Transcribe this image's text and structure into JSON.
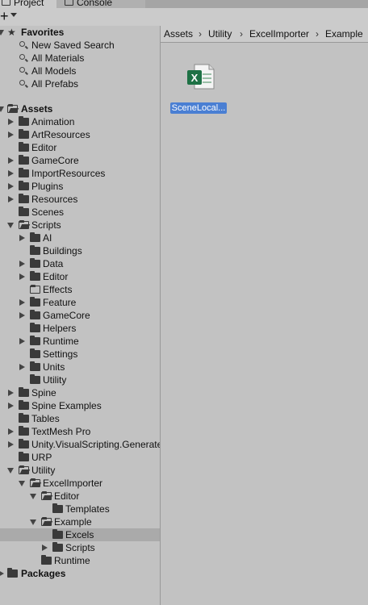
{
  "tabs": [
    {
      "label": "Project",
      "icon": "folder-icon"
    },
    {
      "label": "Console",
      "icon": "console-icon"
    }
  ],
  "toolbar": {
    "add_label": "+"
  },
  "tree": {
    "favorites": {
      "label": "Favorites",
      "items": [
        "New Saved Search",
        "All Materials",
        "All Models",
        "All Prefabs"
      ]
    },
    "assets_label": "Assets",
    "nodes": [
      {
        "label": "Animation"
      },
      {
        "label": "ArtResources"
      },
      {
        "label": "Editor"
      },
      {
        "label": "GameCore"
      },
      {
        "label": "ImportResources"
      },
      {
        "label": "Plugins"
      },
      {
        "label": "Resources"
      },
      {
        "label": "Scenes"
      },
      {
        "label": "Scripts"
      },
      {
        "label": "AI"
      },
      {
        "label": "Buildings"
      },
      {
        "label": "Data"
      },
      {
        "label": "Editor"
      },
      {
        "label": "Effects"
      },
      {
        "label": "Feature"
      },
      {
        "label": "GameCore"
      },
      {
        "label": "Helpers"
      },
      {
        "label": "Runtime"
      },
      {
        "label": "Settings"
      },
      {
        "label": "Units"
      },
      {
        "label": "Utility"
      },
      {
        "label": "Spine"
      },
      {
        "label": "Spine Examples"
      },
      {
        "label": "Tables"
      },
      {
        "label": "TextMesh Pro"
      },
      {
        "label": "Unity.VisualScripting.Generated"
      },
      {
        "label": "URP"
      },
      {
        "label": "Utility"
      },
      {
        "label": "ExcelImporter"
      },
      {
        "label": "Editor"
      },
      {
        "label": "Templates"
      },
      {
        "label": "Example"
      },
      {
        "label": "Excels"
      },
      {
        "label": "Scripts"
      },
      {
        "label": "Runtime"
      }
    ],
    "packages_label": "Packages"
  },
  "breadcrumb": [
    "Assets",
    "Utility",
    "ExcelImporter",
    "Example"
  ],
  "assets": [
    {
      "label": "SceneLocal...",
      "icon": "excel-file-icon",
      "color": "#1e7145"
    }
  ],
  "colors": {
    "selection": "#4a7fd3",
    "excel_green": "#1e7145"
  }
}
